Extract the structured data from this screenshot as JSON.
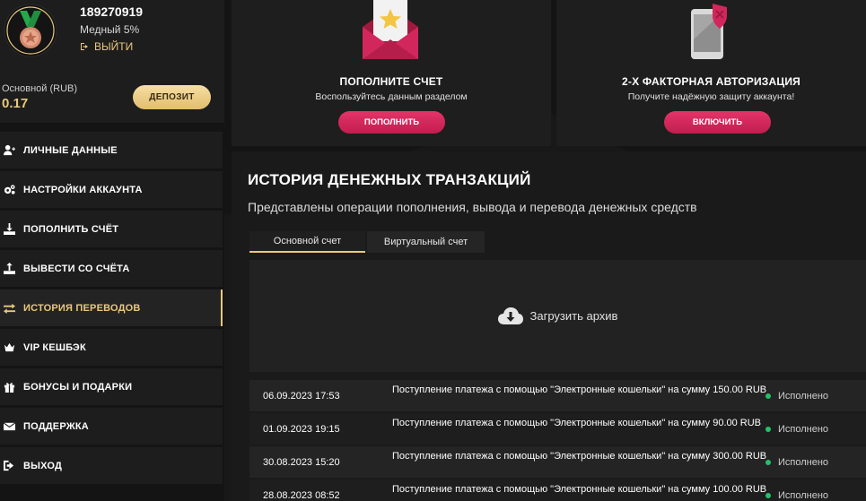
{
  "profile": {
    "user_id": "189270919",
    "level": "Медный 5%",
    "logout_label": "ВЫЙТИ",
    "balance_label": "Основной (RUB)",
    "balance_value": "0.17",
    "deposit_label": "ДЕПОЗИТ"
  },
  "menu": {
    "items": [
      {
        "label": "ЛИЧНЫЕ ДАННЫЕ",
        "icon": "user-icon"
      },
      {
        "label": "НАСТРОЙКИ АККАУНТА",
        "icon": "gears-icon"
      },
      {
        "label": "ПОПОЛНИТЬ СЧЁТ",
        "icon": "download-icon"
      },
      {
        "label": "ВЫВЕСТИ СО СЧЁТА",
        "icon": "upload-icon"
      },
      {
        "label": "ИСТОРИЯ ПЕРЕВОДОВ",
        "icon": "exchange-icon",
        "active": true
      },
      {
        "label": "VIP КЕШБЭК",
        "icon": "crown-icon"
      },
      {
        "label": "БОНУСЫ И ПОДАРКИ",
        "icon": "gift-icon"
      },
      {
        "label": "ПОДДЕРЖКА",
        "icon": "envelope-icon"
      },
      {
        "label": "ВЫХОД",
        "icon": "logout-icon"
      }
    ]
  },
  "cards": {
    "deposit": {
      "title": "ПОПОЛНИТЕ СЧЕТ",
      "subtitle": "Воспользуйтесь данным разделом",
      "button": "ПОПОЛНИТЬ"
    },
    "twofa": {
      "title": "2-Х ФАКТОРНАЯ АВТОРИЗАЦИЯ",
      "subtitle": "Получите надёжную защиту аккаунта!",
      "button": "ВКЛЮЧИТЬ"
    }
  },
  "history": {
    "title": "ИСТОРИЯ ДЕНЕЖНЫХ ТРАНЗАКЦИЙ",
    "subtitle": "Представлены операции пополнения, вывода и перевода денежных средств",
    "tabs": [
      {
        "label": "Основной счет",
        "active": true
      },
      {
        "label": "Виртуальный счет",
        "active": false
      }
    ],
    "archive_label": "Загрузить архив",
    "transactions": [
      {
        "date": "06.09.2023 17:53",
        "description": "Поступление платежа с помощью \"Электронные кошельки\" на сумму 150.00 RUB",
        "status": "Исполнено"
      },
      {
        "date": "01.09.2023 19:15",
        "description": "Поступление платежа с помощью \"Электронные кошельки\" на сумму 90.00 RUB",
        "status": "Исполнено"
      },
      {
        "date": "30.08.2023 15:20",
        "description": "Поступление платежа с помощью \"Электронные кошельки\" на сумму 300.00 RUB",
        "status": "Исполнено"
      },
      {
        "date": "28.08.2023 08:52",
        "description": "Поступление платежа с помощью \"Электронные кошельки\" на сумму 100.00 RUB",
        "status": "Исполнено"
      }
    ]
  },
  "colors": {
    "accent_gold": "#e9c87d",
    "accent_pink": "#d2275d",
    "status_green": "#24c16b",
    "background": "#141414"
  }
}
